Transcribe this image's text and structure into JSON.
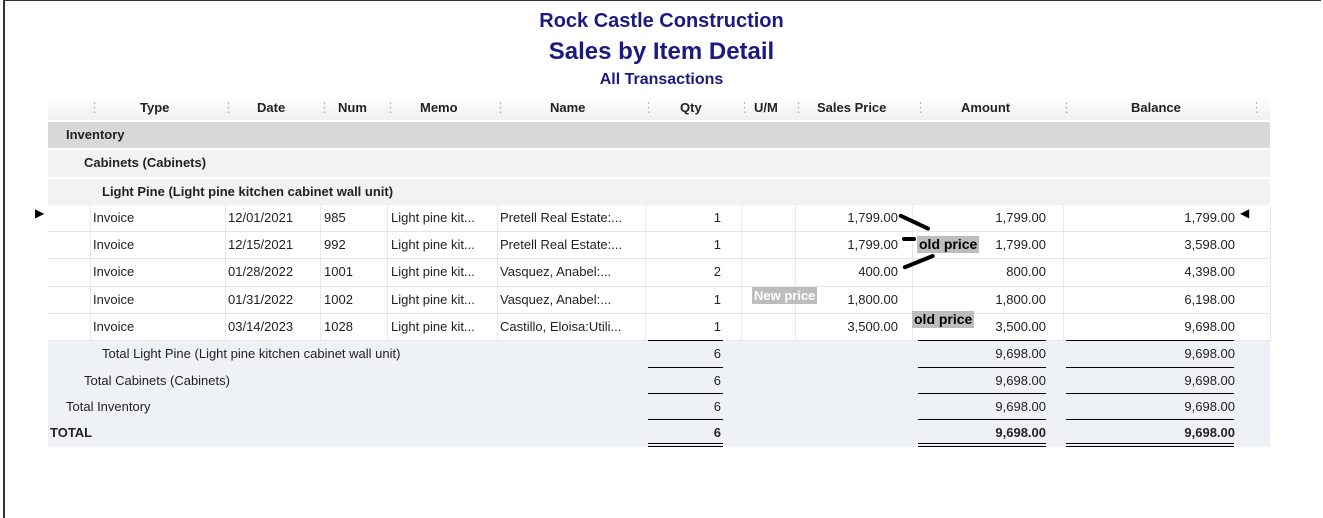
{
  "report": {
    "company": "Rock Castle Construction",
    "title": "Sales by Item Detail",
    "subtitle": "All Transactions"
  },
  "columns": [
    "Type",
    "Date",
    "Num",
    "Memo",
    "Name",
    "Qty",
    "U/M",
    "Sales Price",
    "Amount",
    "Balance"
  ],
  "groups": {
    "inventory": "Inventory",
    "cabinets": "Cabinets (Cabinets)",
    "light_pine": "Light Pine (Light pine kitchen cabinet wall unit)"
  },
  "rows": [
    {
      "type": "Invoice",
      "date": "12/01/2021",
      "num": "985",
      "memo": "Light pine kit...",
      "name": "Pretell Real Estate:...",
      "qty": "1",
      "um": "",
      "price": "1,799.00",
      "amount": "1,799.00",
      "balance": "1,799.00"
    },
    {
      "type": "Invoice",
      "date": "12/15/2021",
      "num": "992",
      "memo": "Light pine kit...",
      "name": "Pretell Real Estate:...",
      "qty": "1",
      "um": "",
      "price": "1,799.00",
      "amount": "1,799.00",
      "balance": "3,598.00"
    },
    {
      "type": "Invoice",
      "date": "01/28/2022",
      "num": "1001",
      "memo": "Light pine kit...",
      "name": "Vasquez, Anabel:...",
      "qty": "2",
      "um": "",
      "price": "400.00",
      "amount": "800.00",
      "balance": "4,398.00"
    },
    {
      "type": "Invoice",
      "date": "01/31/2022",
      "num": "1002",
      "memo": "Light pine kit...",
      "name": "Vasquez, Anabel:...",
      "qty": "1",
      "um": "",
      "price": "1,800.00",
      "amount": "1,800.00",
      "balance": "6,198.00"
    },
    {
      "type": "Invoice",
      "date": "03/14/2023",
      "num": "1028",
      "memo": "Light pine kit...",
      "name": "Castillo, Eloisa:Utili...",
      "qty": "1",
      "um": "",
      "price": "3,500.00",
      "amount": "3,500.00",
      "balance": "9,698.00"
    }
  ],
  "totals": [
    {
      "label": "Total Light Pine (Light pine kitchen cabinet wall unit)",
      "qty": "6",
      "amount": "9,698.00",
      "balance": "9,698.00"
    },
    {
      "label": "Total Cabinets (Cabinets)",
      "qty": "6",
      "amount": "9,698.00",
      "balance": "9,698.00"
    },
    {
      "label": "Total Inventory",
      "qty": "6",
      "amount": "9,698.00",
      "balance": "9,698.00"
    },
    {
      "label": "TOTAL",
      "qty": "6",
      "amount": "9,698.00",
      "balance": "9,698.00"
    }
  ],
  "annotations": {
    "old1": "old price",
    "new": "New price",
    "old2": "old price"
  }
}
